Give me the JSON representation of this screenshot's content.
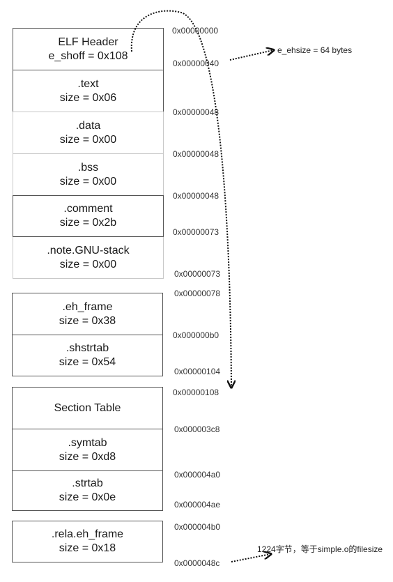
{
  "sections": {
    "group1": [
      {
        "name": "ELF Header",
        "detail": "e_shoff = 0x108"
      },
      {
        "name": ".text",
        "detail": "size = 0x06"
      },
      {
        "name": ".data",
        "detail": "size = 0x00"
      },
      {
        "name": ".bss",
        "detail": "size = 0x00"
      },
      {
        "name": ".comment",
        "detail": "size = 0x2b"
      },
      {
        "name": ".note.GNU-stack",
        "detail": "size = 0x00"
      }
    ],
    "group2": [
      {
        "name": ".eh_frame",
        "detail": "size = 0x38"
      },
      {
        "name": ".shstrtab",
        "detail": "size = 0x54"
      }
    ],
    "group3": [
      {
        "name": "Section Table",
        "detail": ""
      },
      {
        "name": ".symtab",
        "detail": "size = 0xd8"
      },
      {
        "name": ".strtab",
        "detail": "size = 0x0e"
      }
    ],
    "group4": [
      {
        "name": ".rela.eh_frame",
        "detail": "size = 0x18"
      }
    ]
  },
  "addresses": [
    "0x00000000",
    "0x00000040",
    "0x00000048",
    "0x00000048",
    "0x00000048",
    "0x00000073",
    "0x00000073",
    "0x00000078",
    "0x000000b0",
    "0x00000104",
    "0x00000108",
    "0x000003c8",
    "0x000004a0",
    "0x000004ae",
    "0x000004b0",
    "0x0000048c"
  ],
  "annotations": {
    "ehsize": "e_ehsize = 64 bytes",
    "filesize": "1224字节，等于simple.o的filesize"
  }
}
